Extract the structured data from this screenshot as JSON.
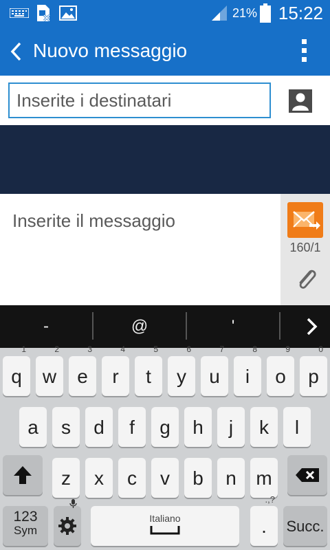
{
  "status_bar": {
    "battery_percent": "21%",
    "time": "15:22",
    "icons": [
      "keyboard-icon",
      "sim-card-icon",
      "image-icon",
      "signal-icon",
      "battery-icon"
    ]
  },
  "action_bar": {
    "title": "Nuovo messaggio",
    "icons": [
      "back-arrow-icon",
      "overflow-menu-icon"
    ],
    "color": "#1770c8"
  },
  "recipients": {
    "placeholder": "Inserite i destinatari"
  },
  "composer": {
    "placeholder": "Inserite il messaggio",
    "char_counter": "160/1",
    "send_color": "#f07c18"
  },
  "suggestions": [
    "-",
    "@",
    "'"
  ],
  "keyboard": {
    "row1": [
      {
        "key": "q",
        "hint": "1"
      },
      {
        "key": "w",
        "hint": "2"
      },
      {
        "key": "e",
        "hint": "3"
      },
      {
        "key": "r",
        "hint": "4"
      },
      {
        "key": "t",
        "hint": "5"
      },
      {
        "key": "y",
        "hint": "6"
      },
      {
        "key": "u",
        "hint": "7"
      },
      {
        "key": "i",
        "hint": "8"
      },
      {
        "key": "o",
        "hint": "9"
      },
      {
        "key": "p",
        "hint": "0"
      }
    ],
    "row2": [
      "a",
      "s",
      "d",
      "f",
      "g",
      "h",
      "j",
      "k",
      "l"
    ],
    "row3": [
      "z",
      "x",
      "c",
      "v",
      "b",
      "n",
      "m"
    ],
    "sym_label_top": "123",
    "sym_label_bottom": "Sym",
    "space_label": "Italiano",
    "period_label": ".",
    "next_label": "Succ."
  }
}
